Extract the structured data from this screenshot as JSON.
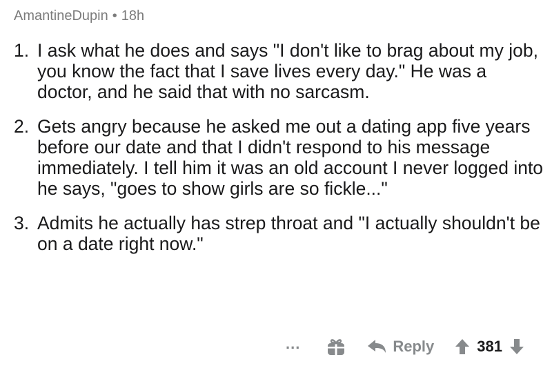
{
  "comment": {
    "author": "AmantineDupin",
    "separator": "•",
    "age": "18h",
    "items": [
      {
        "number": "1.",
        "text": "I ask what he does and says \"I don't like to brag about my job, you know the fact that I save lives every day.\" He was a doctor, and he said that with no sarcasm."
      },
      {
        "number": "2.",
        "text": "Gets angry because he asked me out a dating app five years before our date and that I didn't respond to his message immediately. I tell him it was an old account I never logged into he says, \"goes to show girls are so fickle...\""
      },
      {
        "number": "3.",
        "text": "Admits he actually has strep throat and \"I actually shouldn't be on a date right now.\""
      }
    ]
  },
  "actions": {
    "more_label": "...",
    "award_icon": "gift-icon",
    "reply_icon": "reply-arrow-icon",
    "reply_label": "Reply",
    "upvote_icon": "arrow-up-icon",
    "score": "381",
    "downvote_icon": "arrow-down-icon"
  }
}
